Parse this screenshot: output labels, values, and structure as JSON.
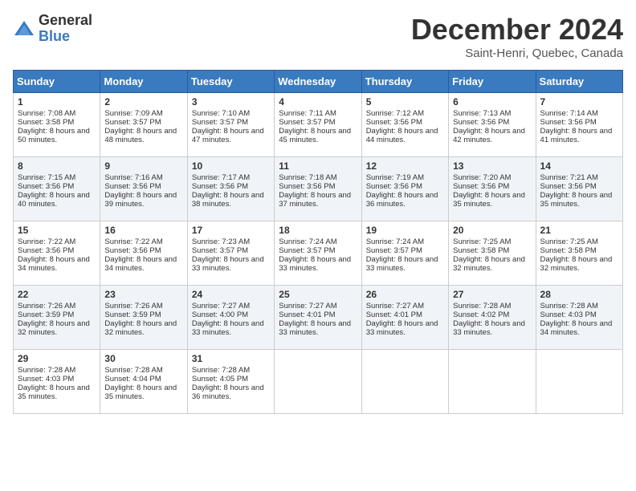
{
  "logo": {
    "general": "General",
    "blue": "Blue"
  },
  "title": "December 2024",
  "subtitle": "Saint-Henri, Quebec, Canada",
  "days_of_week": [
    "Sunday",
    "Monday",
    "Tuesday",
    "Wednesday",
    "Thursday",
    "Friday",
    "Saturday"
  ],
  "weeks": [
    [
      {
        "day": 1,
        "sunrise": "7:08 AM",
        "sunset": "3:58 PM",
        "daylight": "8 hours and 50 minutes."
      },
      {
        "day": 2,
        "sunrise": "7:09 AM",
        "sunset": "3:57 PM",
        "daylight": "8 hours and 48 minutes."
      },
      {
        "day": 3,
        "sunrise": "7:10 AM",
        "sunset": "3:57 PM",
        "daylight": "8 hours and 47 minutes."
      },
      {
        "day": 4,
        "sunrise": "7:11 AM",
        "sunset": "3:57 PM",
        "daylight": "8 hours and 45 minutes."
      },
      {
        "day": 5,
        "sunrise": "7:12 AM",
        "sunset": "3:56 PM",
        "daylight": "8 hours and 44 minutes."
      },
      {
        "day": 6,
        "sunrise": "7:13 AM",
        "sunset": "3:56 PM",
        "daylight": "8 hours and 42 minutes."
      },
      {
        "day": 7,
        "sunrise": "7:14 AM",
        "sunset": "3:56 PM",
        "daylight": "8 hours and 41 minutes."
      }
    ],
    [
      {
        "day": 8,
        "sunrise": "7:15 AM",
        "sunset": "3:56 PM",
        "daylight": "8 hours and 40 minutes."
      },
      {
        "day": 9,
        "sunrise": "7:16 AM",
        "sunset": "3:56 PM",
        "daylight": "8 hours and 39 minutes."
      },
      {
        "day": 10,
        "sunrise": "7:17 AM",
        "sunset": "3:56 PM",
        "daylight": "8 hours and 38 minutes."
      },
      {
        "day": 11,
        "sunrise": "7:18 AM",
        "sunset": "3:56 PM",
        "daylight": "8 hours and 37 minutes."
      },
      {
        "day": 12,
        "sunrise": "7:19 AM",
        "sunset": "3:56 PM",
        "daylight": "8 hours and 36 minutes."
      },
      {
        "day": 13,
        "sunrise": "7:20 AM",
        "sunset": "3:56 PM",
        "daylight": "8 hours and 35 minutes."
      },
      {
        "day": 14,
        "sunrise": "7:21 AM",
        "sunset": "3:56 PM",
        "daylight": "8 hours and 35 minutes."
      }
    ],
    [
      {
        "day": 15,
        "sunrise": "7:22 AM",
        "sunset": "3:56 PM",
        "daylight": "8 hours and 34 minutes."
      },
      {
        "day": 16,
        "sunrise": "7:22 AM",
        "sunset": "3:56 PM",
        "daylight": "8 hours and 34 minutes."
      },
      {
        "day": 17,
        "sunrise": "7:23 AM",
        "sunset": "3:57 PM",
        "daylight": "8 hours and 33 minutes."
      },
      {
        "day": 18,
        "sunrise": "7:24 AM",
        "sunset": "3:57 PM",
        "daylight": "8 hours and 33 minutes."
      },
      {
        "day": 19,
        "sunrise": "7:24 AM",
        "sunset": "3:57 PM",
        "daylight": "8 hours and 33 minutes."
      },
      {
        "day": 20,
        "sunrise": "7:25 AM",
        "sunset": "3:58 PM",
        "daylight": "8 hours and 32 minutes."
      },
      {
        "day": 21,
        "sunrise": "7:25 AM",
        "sunset": "3:58 PM",
        "daylight": "8 hours and 32 minutes."
      }
    ],
    [
      {
        "day": 22,
        "sunrise": "7:26 AM",
        "sunset": "3:59 PM",
        "daylight": "8 hours and 32 minutes."
      },
      {
        "day": 23,
        "sunrise": "7:26 AM",
        "sunset": "3:59 PM",
        "daylight": "8 hours and 32 minutes."
      },
      {
        "day": 24,
        "sunrise": "7:27 AM",
        "sunset": "4:00 PM",
        "daylight": "8 hours and 33 minutes."
      },
      {
        "day": 25,
        "sunrise": "7:27 AM",
        "sunset": "4:01 PM",
        "daylight": "8 hours and 33 minutes."
      },
      {
        "day": 26,
        "sunrise": "7:27 AM",
        "sunset": "4:01 PM",
        "daylight": "8 hours and 33 minutes."
      },
      {
        "day": 27,
        "sunrise": "7:28 AM",
        "sunset": "4:02 PM",
        "daylight": "8 hours and 33 minutes."
      },
      {
        "day": 28,
        "sunrise": "7:28 AM",
        "sunset": "4:03 PM",
        "daylight": "8 hours and 34 minutes."
      }
    ],
    [
      {
        "day": 29,
        "sunrise": "7:28 AM",
        "sunset": "4:03 PM",
        "daylight": "8 hours and 35 minutes."
      },
      {
        "day": 30,
        "sunrise": "7:28 AM",
        "sunset": "4:04 PM",
        "daylight": "8 hours and 35 minutes."
      },
      {
        "day": 31,
        "sunrise": "7:28 AM",
        "sunset": "4:05 PM",
        "daylight": "8 hours and 36 minutes."
      },
      null,
      null,
      null,
      null
    ]
  ],
  "labels": {
    "sunrise": "Sunrise:",
    "sunset": "Sunset:",
    "daylight": "Daylight:"
  }
}
